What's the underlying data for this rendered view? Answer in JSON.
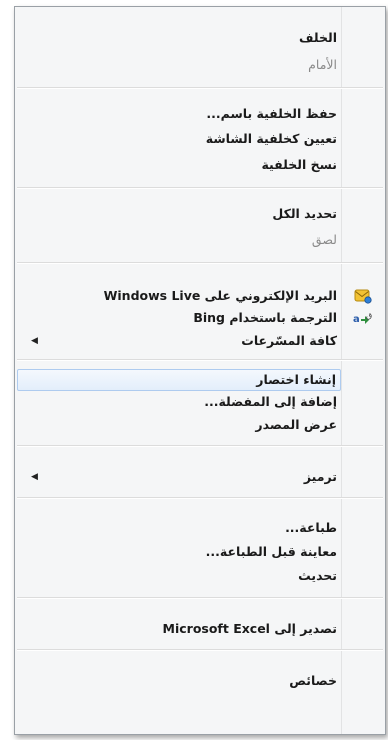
{
  "menu": {
    "items": [
      {
        "label": "الخلف"
      },
      {
        "label": "الأمام"
      },
      {
        "label": "حفظ الخلفية باسم..."
      },
      {
        "label": "تعيين كخلفية الشاشة"
      },
      {
        "label": "نسخ الخلفية"
      },
      {
        "label": "تحديد الكل"
      },
      {
        "label": "لصق"
      },
      {
        "label": "البريد الإلكتروني على Windows Live"
      },
      {
        "label": "الترجمة باستخدام Bing"
      },
      {
        "label": "كافة المسّرعات"
      },
      {
        "label": "إنشاء اختصار"
      },
      {
        "label": "إضافة إلى المفضلة..."
      },
      {
        "label": "عرض المصدر"
      },
      {
        "label": "ترميز"
      },
      {
        "label": "طباعة..."
      },
      {
        "label": "معاينة قبل الطباعة..."
      },
      {
        "label": "تحديث"
      },
      {
        "label": "تصدير إلى Microsoft Excel"
      },
      {
        "label": "خصائص"
      }
    ],
    "submenu_arrow": "◀",
    "icons": [
      "windows-live-mail-icon",
      "bing-translate-icon"
    ]
  }
}
